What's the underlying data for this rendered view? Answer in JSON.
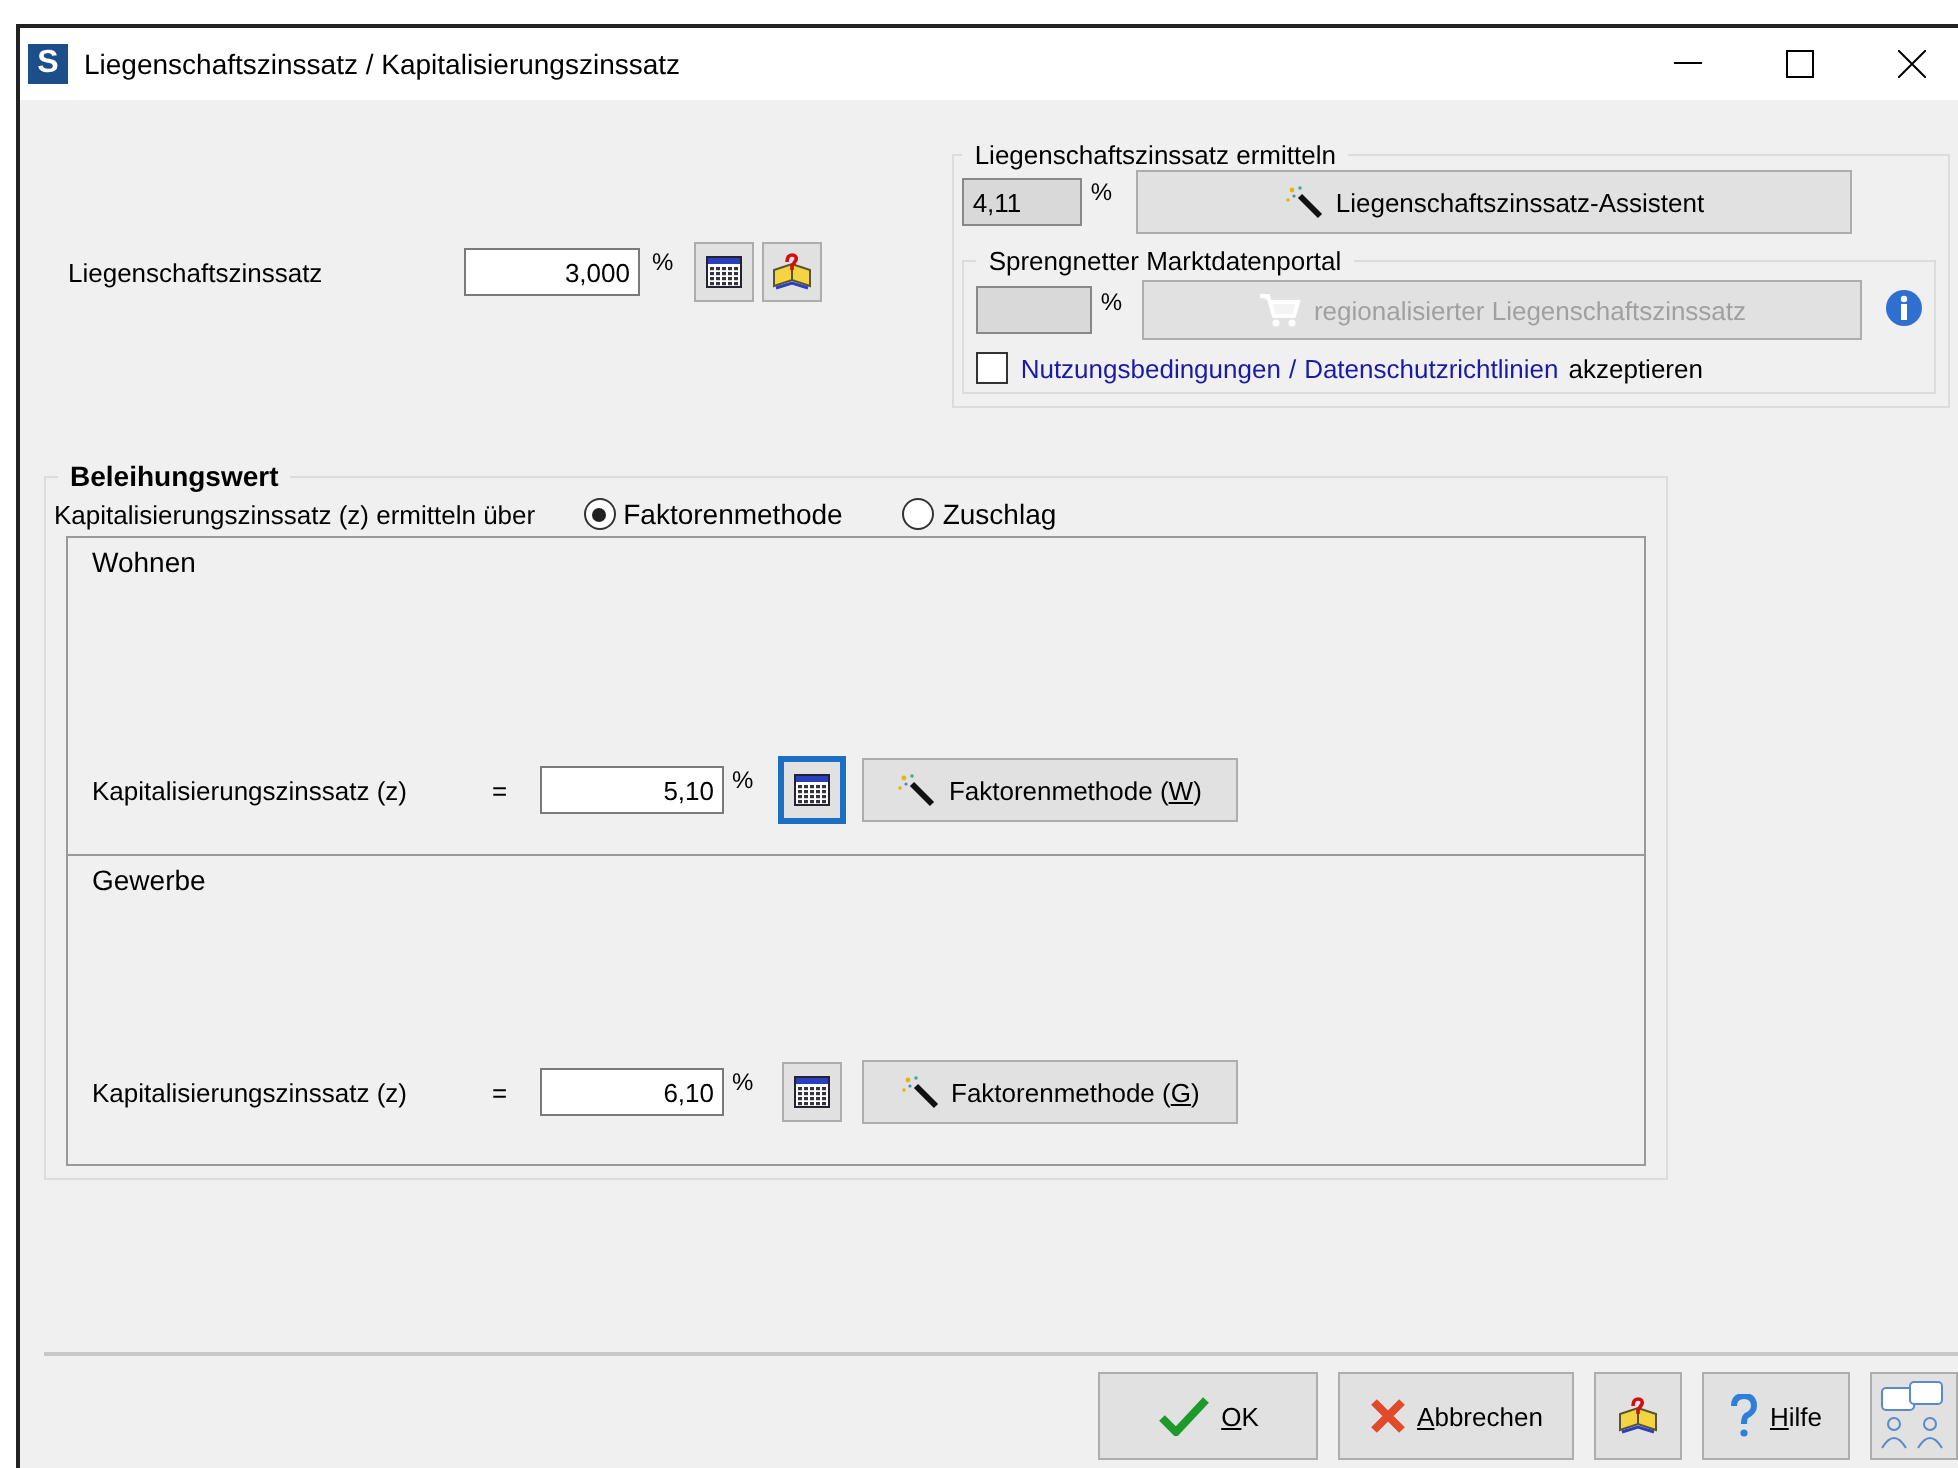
{
  "window": {
    "title": "Liegenschaftszinssatz / Kapitalisierungszinssatz",
    "app_icon": "S"
  },
  "liegenschaftszinssatz": {
    "label": "Liegenschaftszinssatz",
    "value": "3,000",
    "unit": "%"
  },
  "ermitteln": {
    "title": "Liegenschaftszinssatz ermitteln",
    "value": "4,11",
    "unit": "%",
    "button": "Liegenschaftszinssatz-Assistent",
    "portal": {
      "title": "Sprengnetter Marktdatenportal",
      "unit": "%",
      "button": "regionalisierter Liegenschaftszinssatz",
      "button_disabled": true,
      "accept_checked": false,
      "link_1": "Nutzungsbedingungen",
      "separator": "/",
      "link_2": "Datenschutzrichtlinien",
      "accept_text": "akzeptieren"
    }
  },
  "beleihungswert": {
    "title": "Beleihungswert",
    "method_label": "Kapitalisierungszinssatz (z) ermitteln über",
    "methods": [
      {
        "label": "Faktorenmethode",
        "selected": true
      },
      {
        "label": "Zuschlag",
        "selected": false
      }
    ],
    "panels": [
      {
        "title": "Wohnen",
        "label": "Kapitalisierungszinssatz (z)",
        "equals": "=",
        "value": "5,10",
        "unit": "%",
        "focused": true,
        "button": {
          "before": "Faktorenmethode (",
          "accel": "W",
          "after": ")"
        }
      },
      {
        "title": "Gewerbe",
        "label": "Kapitalisierungszinssatz (z)",
        "equals": "=",
        "value": "6,10",
        "unit": "%",
        "focused": false,
        "button": {
          "before": "Faktorenmethode (",
          "accel": "G",
          "after": ")"
        }
      }
    ]
  },
  "buttons": [
    {
      "kind": "ok",
      "accel": "O",
      "after": "K"
    },
    {
      "kind": "cancel",
      "accel": "A",
      "after": "bbrechen"
    },
    {
      "kind": "book"
    },
    {
      "kind": "help",
      "accel": "H",
      "after": "ilfe"
    },
    {
      "kind": "chat"
    }
  ]
}
